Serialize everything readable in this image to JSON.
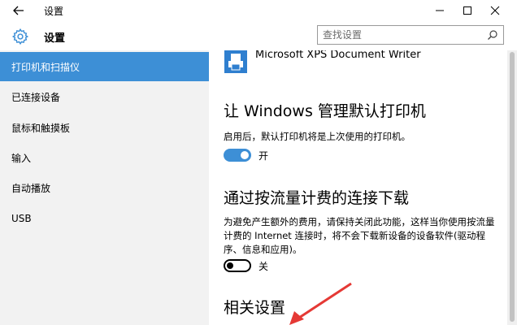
{
  "window": {
    "title": "设置",
    "controls": {
      "minimize": "minimize-icon",
      "maximize": "maximize-icon",
      "close": "close-icon"
    }
  },
  "header": {
    "app_name": "设置",
    "search": {
      "placeholder": "查找设置",
      "value": ""
    }
  },
  "nav": {
    "items": [
      {
        "label": "打印机和扫描仪",
        "active": true
      },
      {
        "label": "已连接设备",
        "active": false
      },
      {
        "label": "鼠标和触摸板",
        "active": false
      },
      {
        "label": "输入",
        "active": false
      },
      {
        "label": "自动播放",
        "active": false
      },
      {
        "label": "USB",
        "active": false
      }
    ]
  },
  "content": {
    "printer": {
      "name": "Microsoft XPS Document Writer"
    },
    "default_printer": {
      "heading": "让 Windows 管理默认打印机",
      "description": "启用后，默认打印机将是上次使用的打印机。",
      "toggle_on": true,
      "toggle_label": "开"
    },
    "metered": {
      "heading": "通过按流量计费的连接下载",
      "description": "为避免产生额外的费用，请保持关闭此功能，这样当你使用按流量计费的 Internet 连接时，将不会下载新设备的设备软件(驱动程序、信息和应用)。",
      "toggle_on": false,
      "toggle_label": "关"
    },
    "related": {
      "heading": "相关设置"
    }
  },
  "colors": {
    "accent": "#3d8fd6",
    "nav_bg": "#f2f2f2",
    "annotation": "#e53935"
  }
}
